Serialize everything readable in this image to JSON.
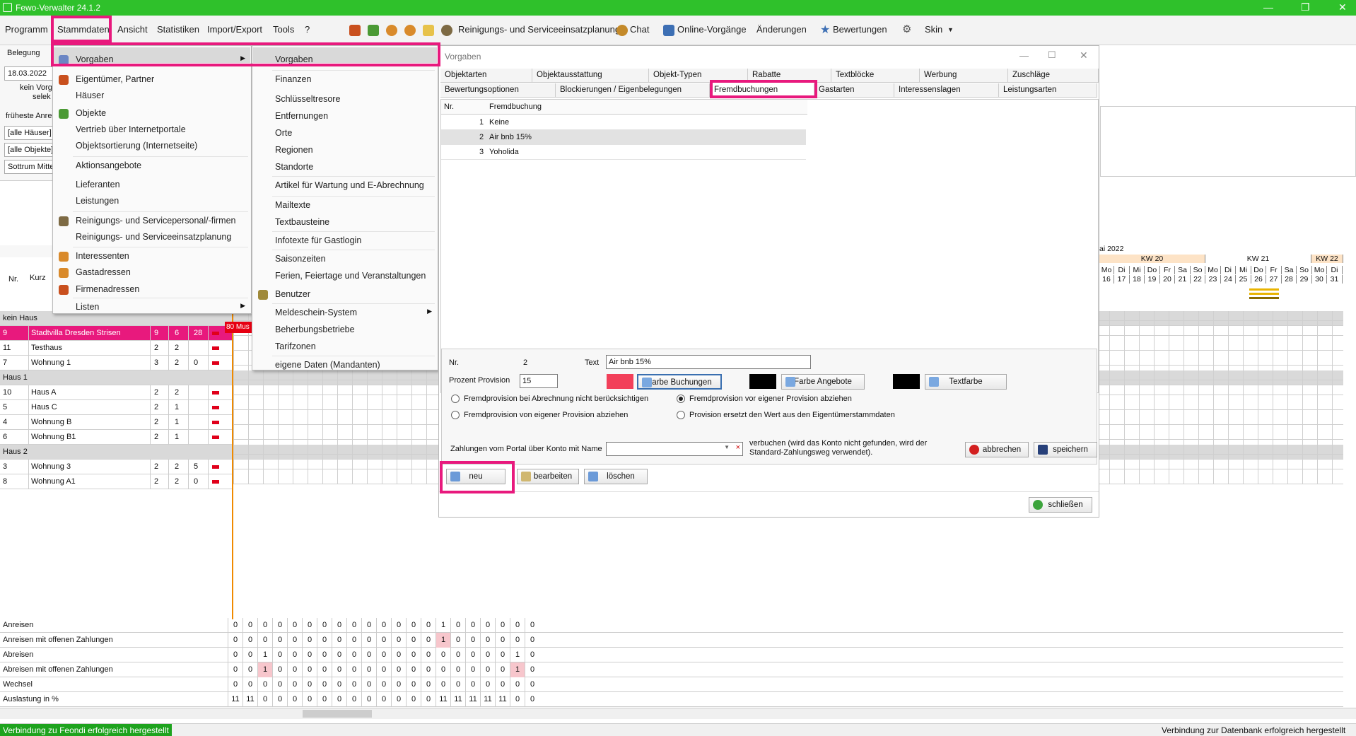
{
  "app": {
    "title": "Fewo-Verwalter 24.1.2"
  },
  "menubar": {
    "items": [
      "Programm",
      "Stammdaten",
      "Ansicht",
      "Statistiken",
      "Import/Export",
      "Tools",
      "?"
    ],
    "toolbar": {
      "reinigung": "Reinigungs- und Serviceeinsatzplanung",
      "chat": "Chat",
      "online": "Online-Vorgänge",
      "aenderungen": "Änderungen",
      "bewertungen": "Bewertungen",
      "skin": "Skin"
    }
  },
  "left": {
    "belegung": "Belegung",
    "date": "18.03.2022",
    "kein1": "kein Vorg",
    "kein2": "selek",
    "frueheste": "früheste Anrei",
    "haeuser": "[alle Häuser]",
    "objekte": "[alle Objekte]",
    "sottrum": "Sottrum Mitte",
    "nr": "Nr.",
    "kurz": "Kurz"
  },
  "menu1": [
    "Vorgaben",
    "Eigentümer, Partner",
    "Häuser",
    "Objekte",
    "Vertrieb über Internetportale",
    "Objektsortierung (Internetseite)",
    "Aktionsangebote",
    "Lieferanten",
    "Leistungen",
    "Reinigungs- und Servicepersonal/-firmen",
    "Reinigungs- und Serviceeinsatzplanung",
    "Interessenten",
    "Gastadressen",
    "Firmenadressen",
    "Listen"
  ],
  "menu2": [
    "Vorgaben",
    "Finanzen",
    "Schlüsseltresore",
    "Entfernungen",
    "Orte",
    "Regionen",
    "Standorte",
    "Artikel für Wartung und E-Abrechnung",
    "Mailtexte",
    "Textbausteine",
    "Infotexte für Gastlogin",
    "Saisonzeiten",
    "Ferien, Feiertage und Veranstaltungen",
    "Benutzer",
    "Meldeschein-System",
    "Beherbungsbetriebe",
    "Tarifzonen",
    "eigene Daten (Mandanten)"
  ],
  "houses": [
    {
      "type": "group",
      "name": "kein Haus"
    },
    {
      "nr": "9",
      "name": "Stadtvilla Dresden Strisen",
      "a": "9",
      "b": "6",
      "c": "28",
      "sel": true
    },
    {
      "nr": "11",
      "name": "Testhaus",
      "a": "2",
      "b": "2",
      "c": ""
    },
    {
      "nr": "7",
      "name": "Wohnung 1",
      "a": "3",
      "b": "2",
      "c": "0"
    },
    {
      "type": "group",
      "name": "Haus 1"
    },
    {
      "nr": "10",
      "name": "Haus A",
      "a": "2",
      "b": "2",
      "c": ""
    },
    {
      "nr": "5",
      "name": "Haus C",
      "a": "2",
      "b": "1",
      "c": ""
    },
    {
      "nr": "4",
      "name": "Wohnung B",
      "a": "2",
      "b": "1",
      "c": ""
    },
    {
      "nr": "6",
      "name": "Wohnung B1",
      "a": "2",
      "b": "1",
      "c": ""
    },
    {
      "type": "group",
      "name": "Haus 2"
    },
    {
      "nr": "3",
      "name": "Wohnung 3",
      "a": "2",
      "b": "2",
      "c": "5"
    },
    {
      "nr": "8",
      "name": "Wohnung A1",
      "a": "2",
      "b": "2",
      "c": "0"
    }
  ],
  "booking_tag": "80 Mus",
  "calendar": {
    "month": "ai 2022",
    "weeks": [
      "KW 20",
      "KW 21",
      "KW 22"
    ],
    "days": [
      "Mo",
      "Di",
      "Mi",
      "Do",
      "Fr",
      "Sa",
      "So",
      "Mo",
      "Di",
      "Mi",
      "Do",
      "Fr",
      "Sa",
      "So",
      "Mo",
      "Di"
    ],
    "dates": [
      "16",
      "17",
      "18",
      "19",
      "20",
      "21",
      "22",
      "23",
      "24",
      "25",
      "26",
      "27",
      "28",
      "29",
      "30",
      "31"
    ]
  },
  "dialog": {
    "title": "Vorgaben",
    "tabs1": [
      "Objektarten",
      "Objektausstattung",
      "Objekt-Typen",
      "Rabatte",
      "Textblöcke",
      "Werbung",
      "Zuschläge"
    ],
    "tabs2": [
      "Bewertungsoptionen",
      "Blockierungen / Eigenbelegungen",
      "Fremdbuchungen",
      "Gastarten",
      "Interessenslagen",
      "Leistungsarten"
    ],
    "col_nr": "Nr.",
    "col_name": "Fremdbuchung",
    "rows": [
      {
        "nr": "1",
        "name": "Keine"
      },
      {
        "nr": "2",
        "name": "Air bnb 15%"
      },
      {
        "nr": "3",
        "name": "Yoholida"
      }
    ],
    "form": {
      "nr_label": "Nr.",
      "nr": "2",
      "text_label": "Text",
      "text": "Air bnb 15%",
      "prov_label": "Prozent Provision",
      "prov": "15",
      "farbe_buchungen": "Farbe Buchungen",
      "farbe_angebote": "Farbe Angebote",
      "textfarbe": "Textfarbe",
      "color_buchungen": "#f2405a",
      "color_angebote": "#000000",
      "color_text": "#000000",
      "r1": "Fremdprovision bei Abrechnung nicht berücksichtigen",
      "r2": "Fremdprovision vor eigener Provision abziehen",
      "r3": "Fremdprovision von eigener Provision abziehen",
      "r4": "Provision ersetzt den Wert aus den Eigentümerstammdaten",
      "zahl_label": "Zahlungen vom Portal über Konto mit Name",
      "verbuchen": "verbuchen (wird das Konto nicht gefunden, wird der",
      "verbuchen2": "Standard-Zahlungsweg verwendet).",
      "abbrechen": "abbrechen",
      "speichern": "speichern"
    },
    "neu": "neu",
    "bearbeiten": "bearbeiten",
    "loeschen": "löschen",
    "schliessen": "schließen"
  },
  "stats": {
    "rows": [
      {
        "label": "Anreisen",
        "vals": [
          "0",
          "0",
          "0",
          "0",
          "0",
          "0",
          "0",
          "0",
          "0",
          "0",
          "0",
          "0",
          "0",
          "0",
          "1",
          "0",
          "0",
          "0",
          "0",
          "0",
          "0"
        ]
      },
      {
        "label": "Anreisen mit offenen Zahlungen",
        "vals": [
          "0",
          "0",
          "0",
          "0",
          "0",
          "0",
          "0",
          "0",
          "0",
          "0",
          "0",
          "0",
          "0",
          "0",
          "1",
          "0",
          "0",
          "0",
          "0",
          "0",
          "0"
        ]
      },
      {
        "label": "Abreisen",
        "vals": [
          "0",
          "0",
          "1",
          "0",
          "0",
          "0",
          "0",
          "0",
          "0",
          "0",
          "0",
          "0",
          "0",
          "0",
          "0",
          "0",
          "0",
          "0",
          "0",
          "1",
          "0"
        ]
      },
      {
        "label": "Abreisen mit offenen Zahlungen",
        "vals": [
          "0",
          "0",
          "1",
          "0",
          "0",
          "0",
          "0",
          "0",
          "0",
          "0",
          "0",
          "0",
          "0",
          "0",
          "0",
          "0",
          "0",
          "0",
          "0",
          "1",
          "0"
        ]
      },
      {
        "label": "Wechsel",
        "vals": [
          "0",
          "0",
          "0",
          "0",
          "0",
          "0",
          "0",
          "0",
          "0",
          "0",
          "0",
          "0",
          "0",
          "0",
          "0",
          "0",
          "0",
          "0",
          "0",
          "0",
          "0"
        ]
      },
      {
        "label": "Auslastung in %",
        "vals": [
          "11",
          "11",
          "0",
          "0",
          "0",
          "0",
          "0",
          "0",
          "0",
          "0",
          "0",
          "0",
          "0",
          "0",
          "11",
          "11",
          "11",
          "11",
          "11",
          "0",
          "0"
        ]
      }
    ]
  },
  "status": {
    "left": "Verbindung zu Feondi erfolgreich hergestellt",
    "right": "Verbindung zur Datenbank erfolgreich hergestellt"
  }
}
